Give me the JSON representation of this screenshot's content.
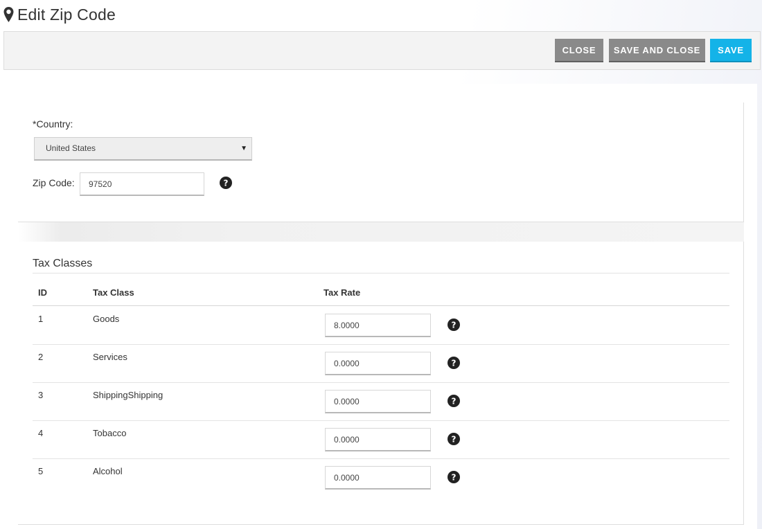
{
  "header": {
    "title": "Edit Zip Code",
    "icon": "map-pin-icon"
  },
  "toolbar": {
    "close_label": "CLOSE",
    "save_and_close_label": "SAVE AND CLOSE",
    "save_label": "SAVE",
    "colors": {
      "grey_button": "#8a8a8a",
      "save_button": "#14b3e8"
    }
  },
  "form": {
    "country_label": "*Country:",
    "country_value": "United States",
    "zip_label": "Zip Code:",
    "zip_value": "97520",
    "help_icon": "question-circle-icon"
  },
  "tax_classes": {
    "title": "Tax Classes",
    "columns": {
      "id": "ID",
      "tax_class": "Tax Class",
      "tax_rate": "Tax Rate"
    },
    "rows": [
      {
        "id": "1",
        "name": "Goods",
        "rate": "8.0000"
      },
      {
        "id": "2",
        "name": "Services",
        "rate": "0.0000"
      },
      {
        "id": "3",
        "name": "ShippingShipping",
        "rate": "0.0000"
      },
      {
        "id": "4",
        "name": "Tobacco",
        "rate": "0.0000"
      },
      {
        "id": "5",
        "name": "Alcohol",
        "rate": "0.0000"
      }
    ]
  }
}
